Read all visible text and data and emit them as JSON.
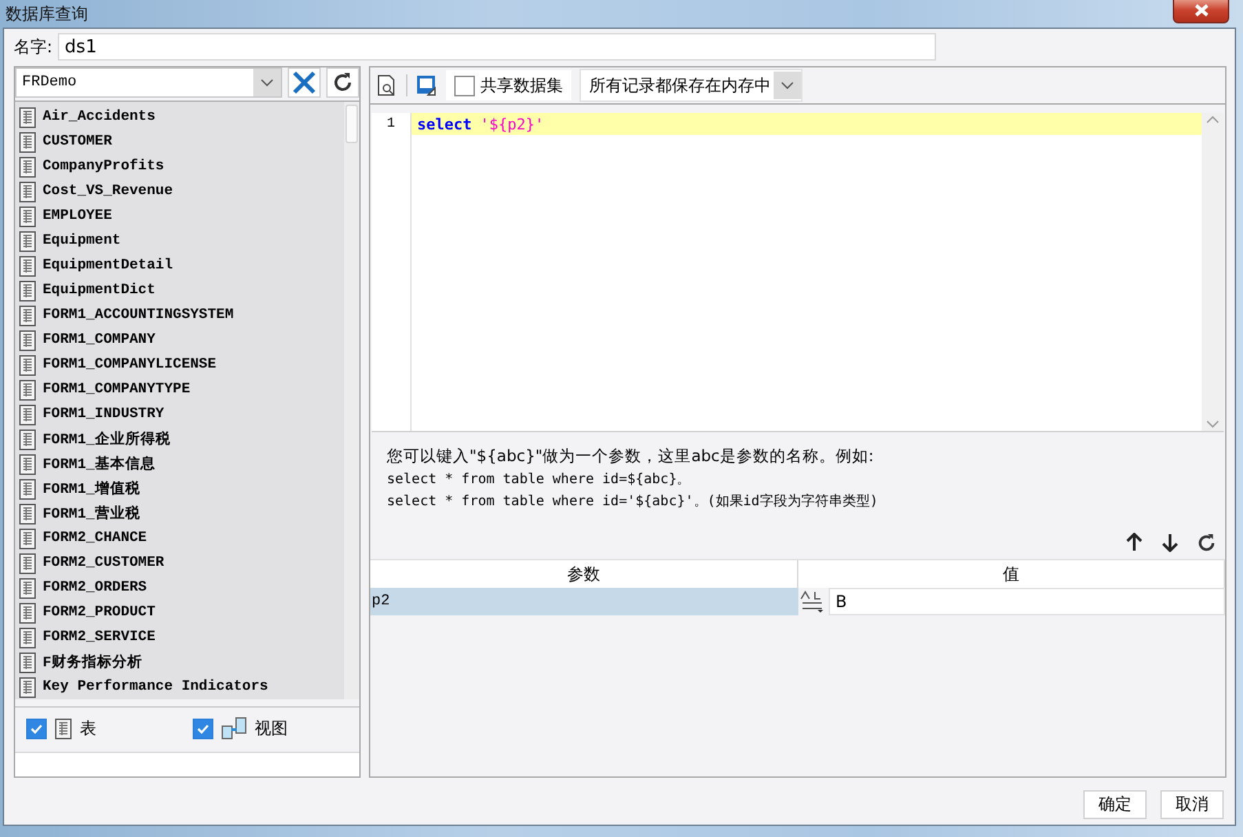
{
  "window": {
    "title": "数据库查询"
  },
  "name_field": {
    "label": "名字:",
    "value": "ds1"
  },
  "connection": {
    "value": "FRDemo"
  },
  "tables": [
    {
      "name": "Air_Accidents"
    },
    {
      "name": "CUSTOMER"
    },
    {
      "name": "CompanyProfits"
    },
    {
      "name": "Cost_VS_Revenue"
    },
    {
      "name": "EMPLOYEE"
    },
    {
      "name": "Equipment"
    },
    {
      "name": "EquipmentDetail"
    },
    {
      "name": "EquipmentDict"
    },
    {
      "name": "FORM1_ACCOUNTINGSYSTEM"
    },
    {
      "name": "FORM1_COMPANY"
    },
    {
      "name": "FORM1_COMPANYLICENSE"
    },
    {
      "name": "FORM1_COMPANYTYPE"
    },
    {
      "name": "FORM1_INDUSTRY"
    },
    {
      "name": "FORM1_企业所得税"
    },
    {
      "name": "FORM1_基本信息"
    },
    {
      "name": "FORM1_增值税"
    },
    {
      "name": "FORM1_营业税"
    },
    {
      "name": "FORM2_CHANCE"
    },
    {
      "name": "FORM2_CUSTOMER"
    },
    {
      "name": "FORM2_ORDERS"
    },
    {
      "name": "FORM2_PRODUCT"
    },
    {
      "name": "FORM2_SERVICE"
    },
    {
      "name": "F财务指标分析"
    },
    {
      "name": "Key Performance Indicators"
    }
  ],
  "filters": [
    {
      "label": "表",
      "checked": true,
      "kind": "table"
    },
    {
      "label": "视图",
      "checked": true,
      "kind": "view"
    }
  ],
  "toolbar": {
    "share": {
      "label": "共享数据集",
      "checked": false
    },
    "storage": "所有记录都保存在内存中"
  },
  "editor": {
    "lines": [
      {
        "number": "1",
        "tokens": [
          {
            "kind": "keyword",
            "text": "select"
          },
          {
            "kind": "string",
            "text": "'${p2}'"
          }
        ]
      }
    ]
  },
  "hint": {
    "lines": [
      "您可以键入\"${abc}\"做为一个参数，这里abc是参数的名称。例如:",
      "select * from table where id=${abc}。",
      "select * from table where id='${abc}'。(如果id字段为字符串类型)"
    ]
  },
  "params": {
    "columns": [
      "参数",
      "值"
    ],
    "rows": [
      {
        "name": "p2",
        "value": "B",
        "selected": true
      }
    ]
  },
  "buttons": [
    "确定",
    "取消"
  ]
}
